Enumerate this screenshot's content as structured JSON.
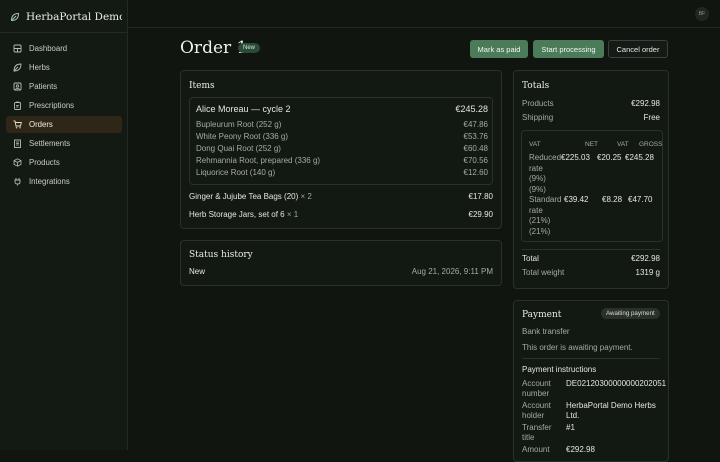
{
  "app": {
    "name": "HerbaPortal Demo ...",
    "user_initials": "BF"
  },
  "sidebar": {
    "items": [
      {
        "label": "Dashboard",
        "icon": "dashboard-icon"
      },
      {
        "label": "Herbs",
        "icon": "leaf-icon"
      },
      {
        "label": "Patients",
        "icon": "patients-icon"
      },
      {
        "label": "Prescriptions",
        "icon": "clipboard-icon"
      },
      {
        "label": "Orders",
        "icon": "cart-icon",
        "active": true
      },
      {
        "label": "Settlements",
        "icon": "receipt-icon"
      },
      {
        "label": "Products",
        "icon": "box-icon"
      },
      {
        "label": "Integrations",
        "icon": "plug-icon"
      }
    ]
  },
  "header": {
    "title": "Order 1",
    "status_badge": "New",
    "actions": {
      "mark_paid": "Mark as paid",
      "start_processing": "Start processing",
      "cancel": "Cancel order"
    }
  },
  "items": {
    "title": "Items",
    "prescription": {
      "name": "Alice Moreau — cycle 2",
      "total": "€245.28",
      "herbs": [
        {
          "name": "Bupleurum Root (252 g)",
          "price": "€47.86"
        },
        {
          "name": "White Peony Root (336 g)",
          "price": "€53.76"
        },
        {
          "name": "Dong Quai Root (252 g)",
          "price": "€60.48"
        },
        {
          "name": "Rehmannia Root, prepared (336 g)",
          "price": "€70.56"
        },
        {
          "name": "Liquorice Root (140 g)",
          "price": "€12.60"
        }
      ]
    },
    "products": [
      {
        "name": "Ginger & Jujube Tea Bags (20)",
        "qty": "× 2",
        "price": "€17.80"
      },
      {
        "name": "Herb Storage Jars, set of 6",
        "qty": "× 1",
        "price": "€29.90"
      }
    ]
  },
  "status_history": {
    "title": "Status history",
    "entries": [
      {
        "status": "New",
        "time": "Aug 21, 2026, 9:11 PM"
      }
    ]
  },
  "totals": {
    "title": "Totals",
    "products_label": "Products",
    "products_value": "€292.98",
    "shipping_label": "Shipping",
    "shipping_value": "Free",
    "vat_headers": [
      "VAT",
      "NET",
      "VAT",
      "GROSS"
    ],
    "vat_rows": [
      {
        "label": [
          "Reduced",
          "rate",
          "(9%)",
          "(9%)"
        ],
        "net": "€225.03",
        "vat": "€20.25",
        "gross": "€245.28"
      },
      {
        "label": [
          "Standard",
          "rate",
          "(21%)",
          "(21%)"
        ],
        "net": "€39.42",
        "vat": "€8.28",
        "gross": "€47.70"
      }
    ],
    "total_label": "Total",
    "total_value": "€292.98",
    "weight_label": "Total weight",
    "weight_value": "1319 g"
  },
  "payment": {
    "title": "Payment",
    "badge": "Awaiting payment",
    "method": "Bank transfer",
    "message": "This order is awaiting payment.",
    "instructions_title": "Payment instructions",
    "fields": [
      {
        "label": [
          "Account",
          "number"
        ],
        "value": [
          "DE02120300000000202051"
        ]
      },
      {
        "label": [
          "Account",
          "holder"
        ],
        "value": [
          "HerbaPortal Demo Herbs",
          "Ltd."
        ]
      },
      {
        "label": [
          "Transfer",
          "title"
        ],
        "value": [
          "#1"
        ]
      },
      {
        "label": [
          "Amount"
        ],
        "value": [
          "€292.98"
        ]
      }
    ]
  },
  "colors": {
    "background": "#101510",
    "accent": "#4b7b58",
    "active_nav": "#2e2616",
    "badge": "#2b4a37"
  }
}
